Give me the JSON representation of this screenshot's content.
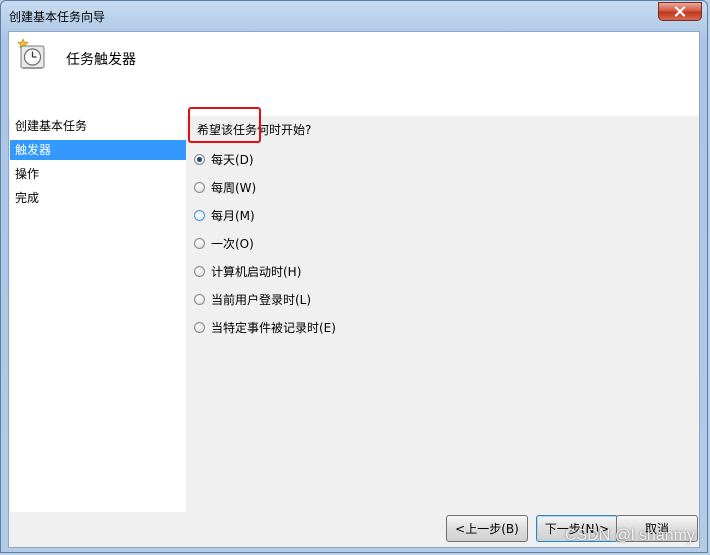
{
  "window": {
    "title": "创建基本任务向导"
  },
  "header": {
    "title": "任务触发器",
    "icon": "clock-task-icon"
  },
  "sidebar": {
    "items": [
      {
        "label": "创建基本任务",
        "active": false
      },
      {
        "label": "触发器",
        "active": true
      },
      {
        "label": "操作",
        "active": false
      },
      {
        "label": "完成",
        "active": false
      }
    ]
  },
  "content": {
    "question": "希望该任务何时开始?",
    "options": [
      {
        "label": "每天(D)",
        "checked": true
      },
      {
        "label": "每周(W)",
        "checked": false
      },
      {
        "label": "每月(M)",
        "checked": false
      },
      {
        "label": "一次(O)",
        "checked": false
      },
      {
        "label": "计算机启动时(H)",
        "checked": false
      },
      {
        "label": "当前用户登录时(L)",
        "checked": false
      },
      {
        "label": "当特定事件被记录时(E)",
        "checked": false
      }
    ]
  },
  "footer": {
    "back_label": "<上一步(B)",
    "next_label": "下一步(N)>",
    "cancel_label": "取消"
  },
  "watermark": "CSDN @l shanmy",
  "colors": {
    "selection": "#3399ff",
    "highlight_border": "#e01010",
    "close_button": "#c2361d"
  }
}
